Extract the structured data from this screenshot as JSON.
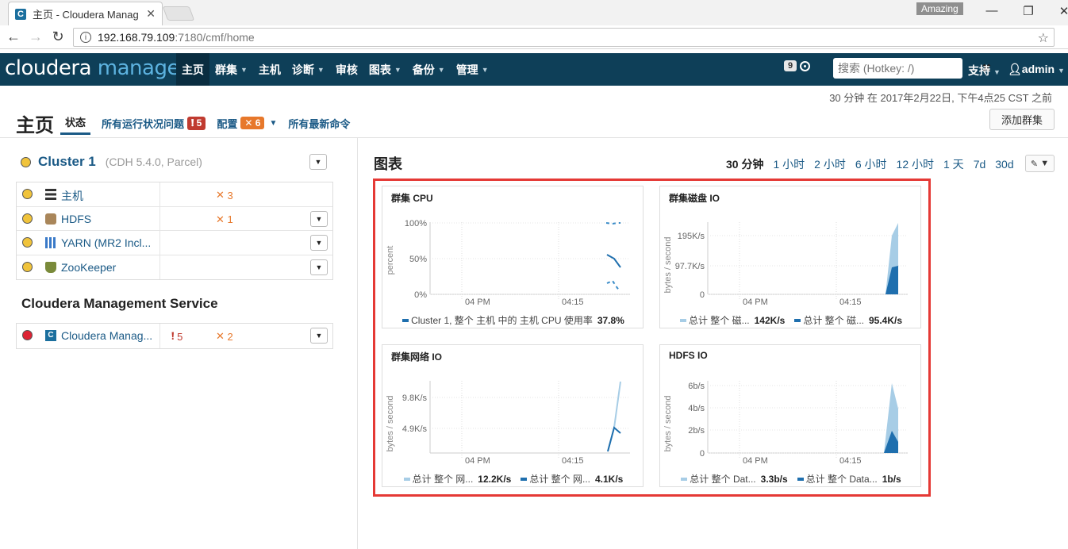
{
  "browser": {
    "tab_title": "主页 - Cloudera Manag",
    "profile": "Amazing",
    "url_host": "192.168.79.109",
    "url_rest": ":7180/cmf/home"
  },
  "nav": {
    "logo_left": "cloudera",
    "logo_right": "manager",
    "items": [
      {
        "label": "主页",
        "active": true,
        "caret": false
      },
      {
        "label": "群集",
        "caret": true
      },
      {
        "label": "主机",
        "caret": false
      },
      {
        "label": "诊断",
        "caret": true
      },
      {
        "label": "审核",
        "caret": false
      },
      {
        "label": "图表",
        "caret": true
      },
      {
        "label": "备份",
        "caret": true
      },
      {
        "label": "管理",
        "caret": true
      }
    ],
    "notifications": "9",
    "search_placeholder": "搜索 (Hotkey: /)",
    "support": "支持",
    "user": "admin"
  },
  "header": {
    "timestamp": "30 分钟 在 2017年2月22日, 下午4点25 CST 之前",
    "title": "主页",
    "tabs": {
      "status": "状态",
      "health_issues": "所有运行状况问题",
      "health_count": "5",
      "config": "配置",
      "config_count": "6",
      "recent_commands": "所有最新命令"
    },
    "add_cluster": "添加群集"
  },
  "cluster": {
    "name": "Cluster 1",
    "version": "(CDH 5.4.0, Parcel)",
    "services": [
      {
        "name": "主机",
        "icon": "hosts-icon",
        "config_count": "3",
        "has_menu": false
      },
      {
        "name": "HDFS",
        "icon": "hdfs-icon",
        "config_count": "1",
        "has_menu": true
      },
      {
        "name": "YARN (MR2 Incl...",
        "icon": "yarn-icon",
        "config_count": "",
        "has_menu": true
      },
      {
        "name": "ZooKeeper",
        "icon": "zookeeper-icon",
        "config_count": "",
        "has_menu": true
      }
    ]
  },
  "cms": {
    "title": "Cloudera Management Service",
    "service": {
      "name": "Cloudera Manag...",
      "health_count": "5",
      "config_count": "2"
    }
  },
  "charts": {
    "title": "图表",
    "ranges": [
      "30 分钟",
      "1 小时",
      "2 小时",
      "6 小时",
      "12 小时",
      "1 天",
      "7d",
      "30d"
    ],
    "active_range": "30 分钟",
    "colors": {
      "light": "#a7cde6",
      "dark": "#1f6fae"
    }
  },
  "chart_data": [
    {
      "type": "line",
      "title": "群集 CPU",
      "ylabel": "percent",
      "yticks": [
        "100%",
        "50%",
        "0%"
      ],
      "xticks": [
        "04 PM",
        "04:15"
      ],
      "series": [
        {
          "name": "Cluster 1, 整个 主机 中的 主机 CPU 使用率",
          "value_label": "37.8%"
        }
      ]
    },
    {
      "type": "area",
      "title": "群集磁盘 IO",
      "ylabel": "bytes / second",
      "yticks": [
        "195K/s",
        "97.7K/s",
        "0"
      ],
      "xticks": [
        "04 PM",
        "04:15"
      ],
      "series": [
        {
          "name": "总计 整个 磁...",
          "value_label": "142K/s"
        },
        {
          "name": "总计 整个 磁...",
          "value_label": "95.4K/s"
        }
      ]
    },
    {
      "type": "line",
      "title": "群集网络 IO",
      "ylabel": "bytes / second",
      "yticks": [
        "9.8K/s",
        "4.9K/s"
      ],
      "xticks": [
        "04 PM",
        "04:15"
      ],
      "series": [
        {
          "name": "总计 整个 网...",
          "value_label": "12.2K/s"
        },
        {
          "name": "总计 整个 网...",
          "value_label": "4.1K/s"
        }
      ]
    },
    {
      "type": "area",
      "title": "HDFS IO",
      "ylabel": "bytes / second",
      "yticks": [
        "6b/s",
        "4b/s",
        "2b/s",
        "0"
      ],
      "xticks": [
        "04 PM",
        "04:15"
      ],
      "series": [
        {
          "name": "总计 整个 Dat...",
          "value_label": "3.3b/s"
        },
        {
          "name": "总计 整个 Data...",
          "value_label": "1b/s"
        }
      ]
    }
  ]
}
